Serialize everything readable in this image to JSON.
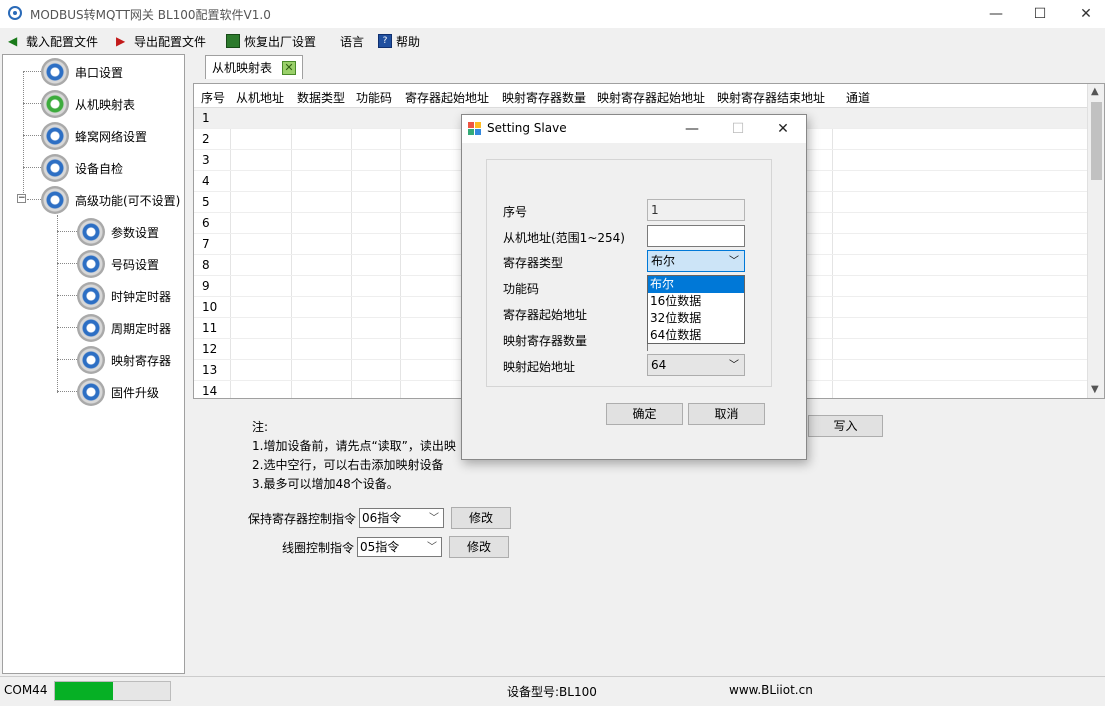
{
  "window": {
    "title": "MODBUS转MQTT网关 BL100配置软件V1.0",
    "controls": {
      "minimize": "—",
      "maximize": "☐",
      "close": "✕"
    }
  },
  "menu": [
    {
      "label": "载入配置文件",
      "icon": "load-arrow-icon"
    },
    {
      "label": "导出配置文件",
      "icon": "export-arrow-icon"
    },
    {
      "label": "恢复出厂设置",
      "icon": "restore-icon"
    },
    {
      "label": "语言",
      "icon": ""
    },
    {
      "label": "帮助",
      "icon": "help-book-icon"
    }
  ],
  "tree": {
    "items": [
      {
        "label": "串口设置"
      },
      {
        "label": "从机映射表"
      },
      {
        "label": "蜂窝网络设置"
      },
      {
        "label": "设备自检"
      },
      {
        "label": "高级功能(可不设置)"
      }
    ],
    "expander": "−",
    "children": [
      {
        "label": "参数设置"
      },
      {
        "label": "号码设置"
      },
      {
        "label": "时钟定时器"
      },
      {
        "label": "周期定时器"
      },
      {
        "label": "映射寄存器"
      },
      {
        "label": "固件升级"
      }
    ]
  },
  "tab": {
    "label": "从机映射表",
    "close": "✕"
  },
  "grid": {
    "headers": [
      "序号",
      "从机地址",
      "数据类型",
      "功能码",
      "寄存器起始地址",
      "映射寄存器数量",
      "映射寄存器起始地址",
      "映射寄存器结束地址",
      "通道"
    ],
    "rows": [
      "1",
      "2",
      "3",
      "4",
      "5",
      "6",
      "7",
      "8",
      "9",
      "10",
      "11",
      "12",
      "13",
      "14"
    ],
    "scroll_up": "▲",
    "scroll_down": "▼"
  },
  "notes": {
    "title": "注:",
    "lines": [
      "1.增加设备前，请先点“读取”，读出映",
      "2.选中空行，可以右击添加映射设备",
      "3.最多可以增加48个设备。"
    ]
  },
  "write_button": "写入",
  "controls": {
    "holding": {
      "label": "保持寄存器控制指令",
      "value": "06指令",
      "button": "修改"
    },
    "coil": {
      "label": "线圈控制指令",
      "value": "05指令",
      "button": "修改"
    }
  },
  "status": {
    "port": "COM44",
    "progress_fraction": 0.5,
    "device_model": "设备型号:BL100",
    "website": "www.BLiiot.cn"
  },
  "dialog": {
    "title": "Setting Slave",
    "controls": {
      "minimize": "—",
      "maximize": "☐",
      "close": "✕"
    },
    "fields": {
      "seq": {
        "label": "序号",
        "value": "1"
      },
      "slave_addr": {
        "label": "从机地址(范围1~254)",
        "value": ""
      },
      "reg_type": {
        "label": "寄存器类型",
        "value": "布尔"
      },
      "func_code": {
        "label": "功能码"
      },
      "reg_start": {
        "label": "寄存器起始地址"
      },
      "map_count": {
        "label": "映射寄存器数量"
      },
      "map_start": {
        "label": "映射起始地址",
        "value": "64"
      }
    },
    "dropdown_options": [
      "布尔",
      "16位数据",
      "32位数据",
      "64位数据"
    ],
    "ok": "确定",
    "cancel": "取消"
  },
  "colors": {
    "accent": "#0078d7",
    "progress": "#06b025",
    "gear_blue": "#2d6fc4",
    "gear_green": "#3dab3d"
  }
}
